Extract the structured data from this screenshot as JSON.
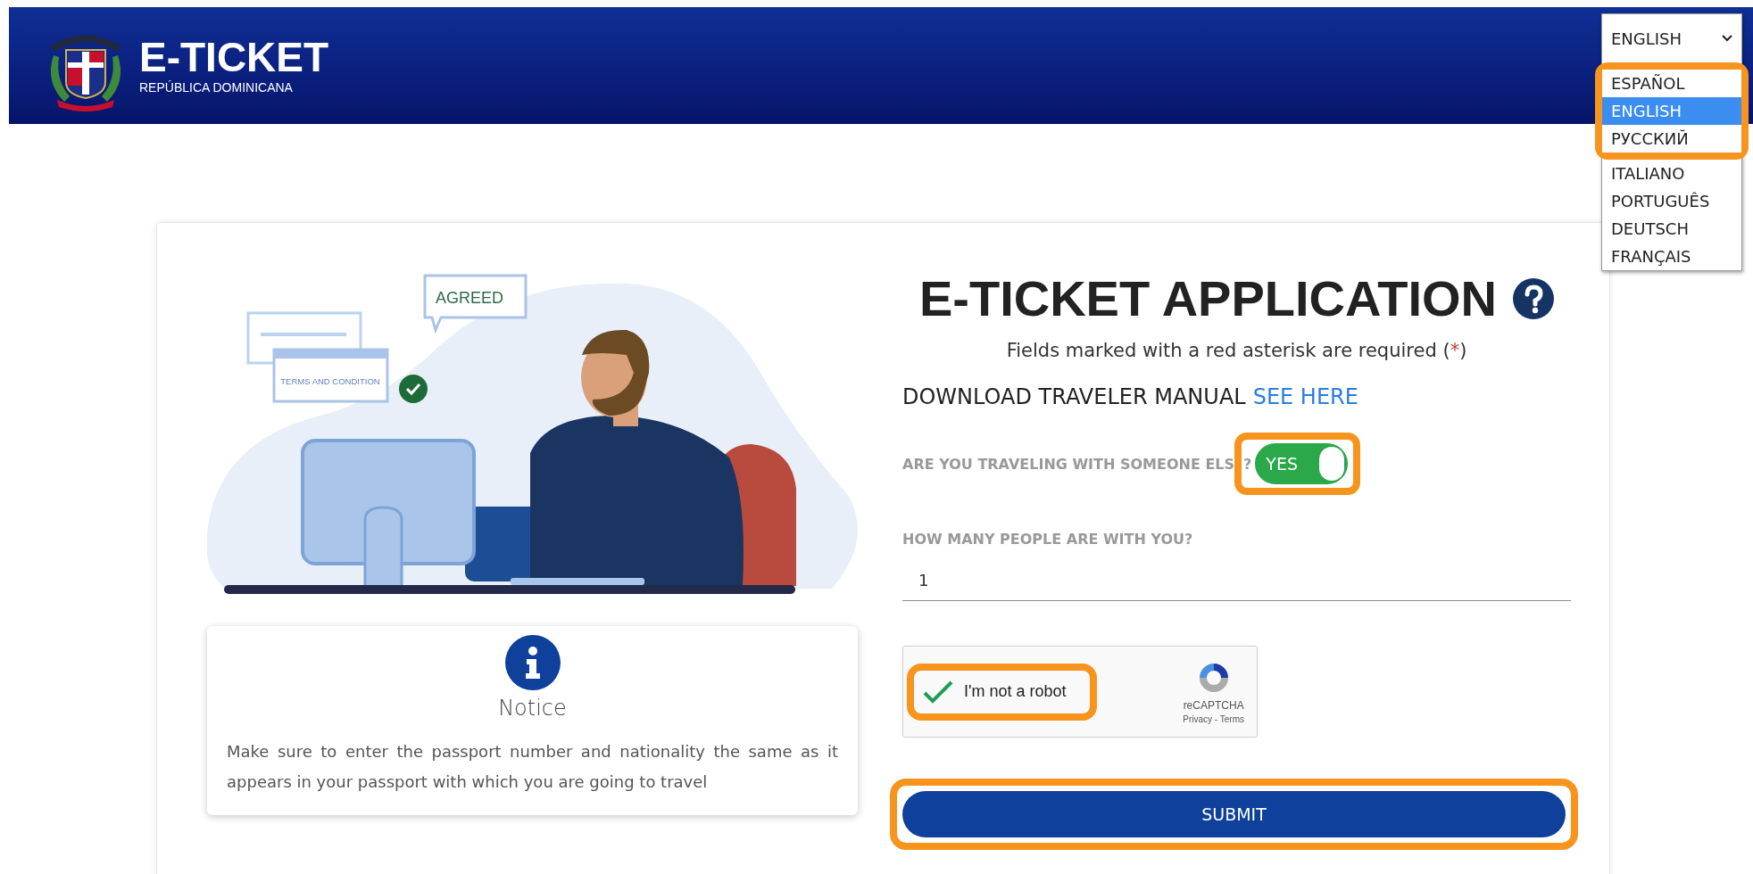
{
  "header": {
    "title": "E-TICKET",
    "subtitle": "REPÚBLICA DOMINICANA",
    "language_select": {
      "value": "ENGLISH",
      "expanded": true,
      "options": [
        {
          "label": "ESPAÑOL",
          "selected": false,
          "highlighted": true
        },
        {
          "label": "ENGLISH",
          "selected": true,
          "highlighted": true
        },
        {
          "label": "РУССКИЙ",
          "selected": false,
          "highlighted": true
        },
        {
          "label": "ITALIANO",
          "selected": false,
          "highlighted": false
        },
        {
          "label": "PORTUGUÊS",
          "selected": false,
          "highlighted": false
        },
        {
          "label": "DEUTSCH",
          "selected": false,
          "highlighted": false
        },
        {
          "label": "FRANÇAIS",
          "selected": false,
          "highlighted": false
        }
      ]
    }
  },
  "illustration": {
    "bubble_text": "AGREED",
    "window_text": "TERMS AND CONDITION"
  },
  "notice": {
    "title": "Notice",
    "text": "Make sure to enter the passport number and nationality the same as it appears in your passport with which you are going to travel"
  },
  "form": {
    "title": "E-TICKET APPLICATION",
    "required_note": {
      "text": "Fields marked with a red asterisk are required (",
      "asterisk": "*",
      "close": ")"
    },
    "manual": {
      "text": "DOWNLOAD TRAVELER MANUAL",
      "link": "SEE HERE"
    },
    "companion": {
      "label": "ARE YOU TRAVELING WITH SOMEONE ELS",
      "label_end": "?",
      "toggle_label": "YES",
      "on": true,
      "highlighted": true
    },
    "people": {
      "label": "HOW MANY PEOPLE ARE WITH YOU?",
      "value": "1"
    },
    "captcha": {
      "label": "I'm not a robot",
      "checked": true,
      "highlighted": true,
      "brand": "reCAPTCHA",
      "links": "Privacy - Terms"
    },
    "submit": {
      "label": "SUBMIT",
      "highlighted": true
    }
  }
}
